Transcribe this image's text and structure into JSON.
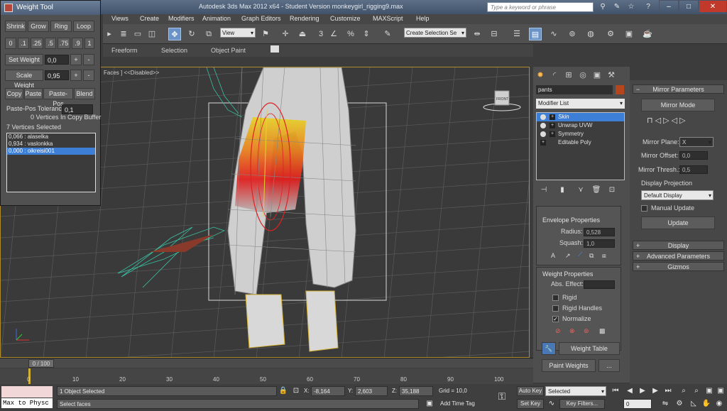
{
  "titlebar": {
    "title": "Autodesk 3ds Max  2012 x64  -  Student Version    monkeygirl_rigging9.max",
    "search_placeholder": "Type a keyword or phrase",
    "min": "–",
    "max": "□",
    "close": "✕"
  },
  "menu": [
    "Views",
    "Create",
    "Modifiers",
    "Animation",
    "Graph Editors",
    "Rendering",
    "Customize",
    "MAXScript",
    "Help"
  ],
  "toolbar": {
    "view_select": "View",
    "selection_set": "Create Selection Se",
    "snap_num": "3",
    "percent": "%"
  },
  "ribbon": [
    "Freeform",
    "Selection",
    "Object Paint"
  ],
  "viewport": {
    "label": "Faces ] <<Disabled>>",
    "viewcube": "FRONT",
    "mesh_color": "#d9d9d9",
    "bone_color": "#39c0a0",
    "envelope_color": "#d33"
  },
  "weight_tool": {
    "title": "Weight Tool",
    "row1": [
      "Shrink",
      "Grow",
      "Ring",
      "Loop"
    ],
    "row2": [
      "0",
      ".1",
      ".25",
      ".5",
      ".75",
      ".9",
      "1"
    ],
    "set_weight_label": "Set Weight",
    "set_weight_value": "0,0",
    "scale_weight_label": "Scale Weight",
    "scale_weight_value": "0,95",
    "plus": "+",
    "minus": "-",
    "row3": [
      "Copy",
      "Paste",
      "Paste-Pos",
      "Blend"
    ],
    "tolerance_label": "Paste-Pos Tolerance",
    "tolerance_value": "0,1",
    "copy_buffer": "0 Vertices In Copy Buffer",
    "vertices_selected": "7 Vertices Selected",
    "list": [
      "0,066 : alaselka",
      "0,934 : vaslonkka",
      "0,000 : oikreisi001"
    ]
  },
  "command_panel": {
    "object_name": "pants",
    "object_color": "#b5451b",
    "modifier_list": "Modifier List",
    "stack": [
      "Skin",
      "Unwrap UVW",
      "Symmetry",
      "Editable Poly"
    ],
    "envelope_title": "Envelope Properties",
    "radius_label": "Radius:",
    "radius_value": "0,528",
    "squash_label": "Squash:",
    "squash_value": "1,0",
    "weight_title": "Weight Properties",
    "abs_effect_label": "Abs. Effect:",
    "rigid": "Rigid",
    "rigid_handles": "Rigid Handles",
    "normalize": "Normalize",
    "weight_table": "Weight Table",
    "paint_weights": "Paint Weights",
    "ellipsis": "..."
  },
  "mirror": {
    "title": "Mirror Parameters",
    "mirror_mode": "Mirror Mode",
    "plane_label": "Mirror Plane:",
    "plane_value": "X",
    "offset_label": "Mirror Offset:",
    "offset_value": "0,0",
    "thresh_label": "Mirror Thresh.:",
    "thresh_value": "0,5",
    "projection_label": "Display Projection",
    "projection_value": "Default Display",
    "manual_update": "Manual Update",
    "update": "Update",
    "display": "Display",
    "advanced": "Advanced Parameters",
    "gizmos": "Gizmos"
  },
  "timeline": {
    "frame": "0 / 100",
    "ticks": [
      "0",
      "10",
      "20",
      "30",
      "40",
      "50",
      "60",
      "70",
      "80",
      "90",
      "100"
    ]
  },
  "status": {
    "maxscript": "Max to Physc",
    "objects_selected": "1 Object Selected",
    "prompt": "Select faces",
    "x_label": "X:",
    "x_value": "-8,164",
    "y_label": "Y:",
    "y_value": "2,603",
    "z_label": "Z:",
    "z_value": "35,188",
    "grid": "Grid = 10,0",
    "add_time_tag": "Add Time Tag",
    "auto_key": "Auto Key",
    "set_key": "Set Key",
    "key_selected": "Selected",
    "key_filters": "Key Filters...",
    "frame_field": "0"
  }
}
